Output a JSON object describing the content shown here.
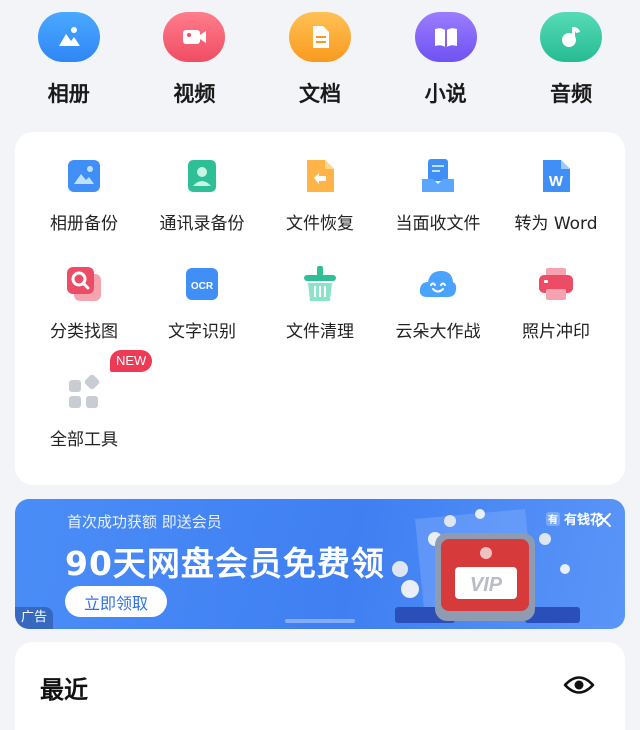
{
  "categories": [
    {
      "label": "相册",
      "icon": "album-icon",
      "color": "#2f86f6"
    },
    {
      "label": "视频",
      "icon": "video-icon",
      "color": "#f04d63"
    },
    {
      "label": "文档",
      "icon": "document-icon",
      "color": "#f99a1f"
    },
    {
      "label": "小说",
      "icon": "book-icon",
      "color": "#6f52f2"
    },
    {
      "label": "音频",
      "icon": "music-icon",
      "color": "#26bb93"
    }
  ],
  "tools": [
    {
      "label": "相册备份",
      "icon": "photo-backup-icon"
    },
    {
      "label": "通讯录备份",
      "icon": "contacts-backup-icon"
    },
    {
      "label": "文件恢复",
      "icon": "file-restore-icon"
    },
    {
      "label": "当面收文件",
      "icon": "receive-file-icon"
    },
    {
      "label": "转为 Word",
      "icon": "word-icon"
    },
    {
      "label": "分类找图",
      "icon": "image-search-icon"
    },
    {
      "label": "文字识别",
      "icon": "ocr-icon"
    },
    {
      "label": "文件清理",
      "icon": "clean-icon"
    },
    {
      "label": "云朵大作战",
      "icon": "cloud-game-icon"
    },
    {
      "label": "照片冲印",
      "icon": "photo-print-icon"
    },
    {
      "label": "全部工具",
      "icon": "all-tools-icon"
    }
  ],
  "new_badge": "NEW",
  "ocr_icon_text": "OCR",
  "word_icon_text": "W",
  "ad": {
    "subtitle": "首次成功获额 即送会员",
    "title": "90天网盘会员免费领",
    "cta": "立即领取",
    "tag": "广告",
    "brand": "有钱花",
    "brand_mark": "有",
    "vip_text": "VIP"
  },
  "recent": {
    "title": "最近"
  }
}
